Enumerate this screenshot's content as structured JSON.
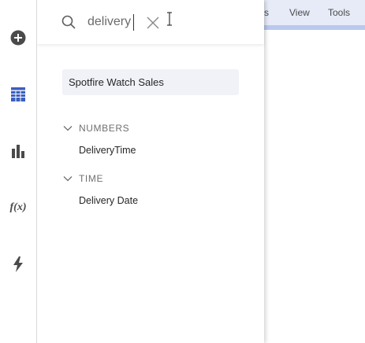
{
  "menubar": {
    "items": [
      {
        "label": "s"
      },
      {
        "label": "View"
      },
      {
        "label": "Tools"
      }
    ],
    "background": "#e6ebf7",
    "accent": "#b9c8ef"
  },
  "rail": {
    "items": [
      {
        "icon": "plus-circle-icon"
      },
      {
        "icon": "data-table-icon"
      },
      {
        "icon": "bar-chart-icon"
      },
      {
        "icon": "fx-icon",
        "glyph": "f(x)"
      },
      {
        "icon": "lightning-icon"
      }
    ],
    "icon_color": "#4a4a4a",
    "active_color": "#3b5fc0"
  },
  "flyout": {
    "search": {
      "value": "delivery",
      "icon": "search-icon",
      "clear_icon": "close-icon"
    },
    "data_source": "Spotfire Watch Sales",
    "groups": [
      {
        "label": "NUMBERS",
        "expanded": true,
        "fields": [
          "DeliveryTime"
        ]
      },
      {
        "label": "TIME",
        "expanded": true,
        "fields": [
          "Delivery Date"
        ]
      }
    ]
  }
}
